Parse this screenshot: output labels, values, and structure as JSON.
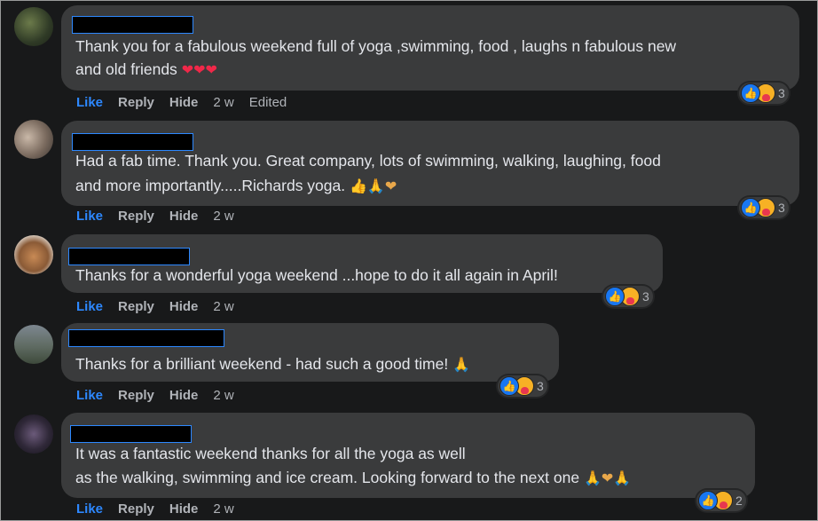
{
  "actions": {
    "like": "Like",
    "reply": "Reply",
    "hide": "Hide"
  },
  "comments": [
    {
      "lines": [
        "Thank you for a fabulous weekend full of yoga ,swimming, food , laughs n fabulous new",
        "and old friends"
      ],
      "emoji": "❤❤❤",
      "time": "2 w",
      "edited": "Edited",
      "reactions": "3"
    },
    {
      "lines": [
        "Had a fab time. Thank you. Great company, lots of swimming, walking, laughing, food",
        "and more importantly.....Richards yoga."
      ],
      "emoji": "👍🙏❤",
      "time": "2 w",
      "reactions": "3"
    },
    {
      "lines": [
        "Thanks for a wonderful yoga weekend ...hope to do it all again in April!"
      ],
      "time": "2 w",
      "reactions": "3"
    },
    {
      "lines": [
        "Thanks for a brilliant weekend - had such a good time!"
      ],
      "emoji": "🙏",
      "time": "2 w",
      "reactions": "3"
    },
    {
      "lines": [
        "It was a fantastic weekend thanks for all the yoga as well",
        "as the walking, swimming and ice cream. Looking forward to the next one"
      ],
      "emoji": "🙏❤🙏",
      "time": "2 w",
      "reactions": "2"
    }
  ],
  "colors": {
    "accent": "#2d88ff",
    "bubble": "#3a3b3c",
    "background": "#18191a",
    "text": "#e4e6eb",
    "muted": "#b0b3b8"
  },
  "icons": [
    "like-reaction-icon",
    "care-reaction-icon"
  ]
}
